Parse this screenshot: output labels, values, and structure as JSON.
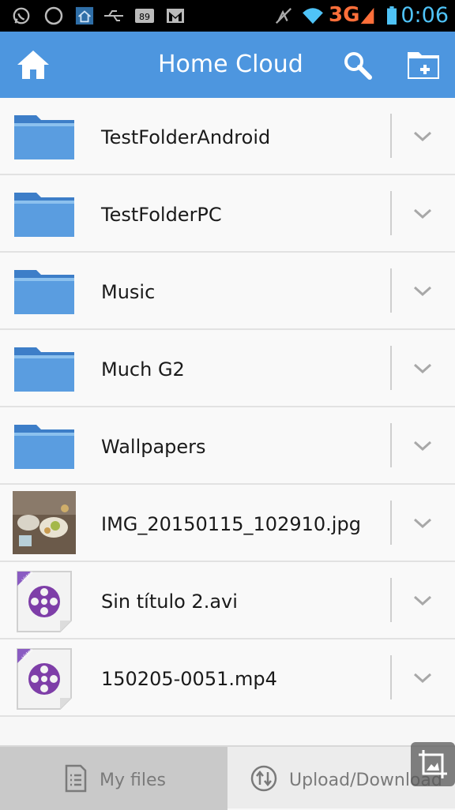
{
  "status_bar": {
    "network": "3G",
    "time": "0:06",
    "icons": [
      "whatsapp-icon",
      "circle-icon",
      "home-cloud-icon",
      "usb-icon",
      "battery-percent-icon",
      "gmail-icon",
      "mute-icon",
      "wifi-icon",
      "signal-icon",
      "battery-icon"
    ]
  },
  "header": {
    "title": "Home Cloud",
    "home_icon": "home-icon",
    "search_icon": "search-icon",
    "new_folder_icon": "new-folder-icon",
    "color": "#4d96df"
  },
  "files": [
    {
      "name": "TestFolderAndroid",
      "type": "folder"
    },
    {
      "name": "TestFolderPC",
      "type": "folder"
    },
    {
      "name": "Music",
      "type": "folder"
    },
    {
      "name": "Much G2",
      "type": "folder"
    },
    {
      "name": "Wallpapers",
      "type": "folder"
    },
    {
      "name": "IMG_20150115_102910.jpg",
      "type": "image"
    },
    {
      "name": "Sin título 2.avi",
      "type": "video"
    },
    {
      "name": "150205-0051.mp4",
      "type": "video"
    }
  ],
  "bottom_tabs": {
    "my_files": "My files",
    "upload_download": "Upload/Download"
  },
  "video_badge": "Video"
}
